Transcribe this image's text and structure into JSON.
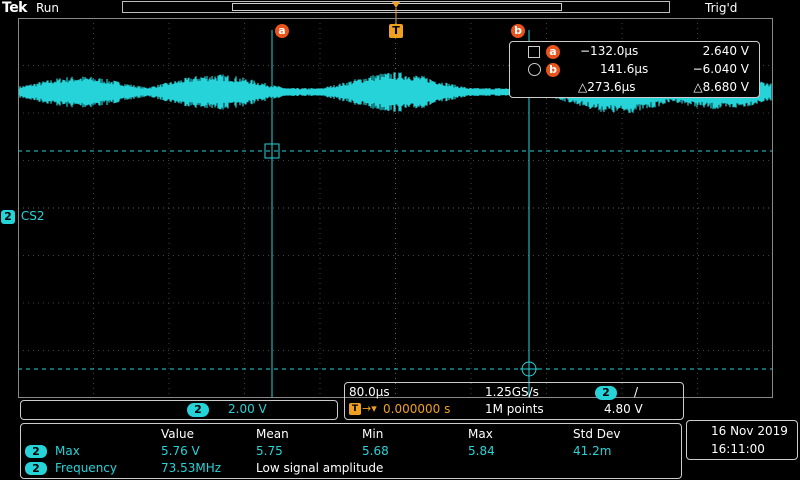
{
  "header": {
    "logo": "Tek",
    "status": "Run",
    "trigger_status": "Trig'd",
    "trigger_marker": "T"
  },
  "cursors": {
    "a_label": "a",
    "b_label": "b",
    "readout": {
      "a_time": "−132.0µs",
      "a_volt": "2.640 V",
      "b_time": "141.6µs",
      "b_volt": "−6.040 V",
      "delta_time": "△273.6µs",
      "delta_volt": "△8.680 V"
    }
  },
  "channel": {
    "badge": "2",
    "label": "CS2",
    "scale": "2.00 V",
    "color": "#26d3d9"
  },
  "timebase": {
    "time_per_div": "80.0µs",
    "sample_rate": "1.25GS/s",
    "trigger_channel": "2",
    "trigger_slope": "/",
    "trigger_position": "0.000000 s",
    "record_length": "1M points",
    "trigger_level": "4.80 V"
  },
  "measurements": {
    "headers": [
      "Value",
      "Mean",
      "Min",
      "Max",
      "Std Dev"
    ],
    "rows": [
      {
        "channel": "2",
        "name": "Max",
        "value": "5.76 V",
        "mean": "5.75",
        "min": "5.68",
        "max": "5.84",
        "stddev": "41.2m"
      },
      {
        "channel": "2",
        "name": "Frequency",
        "value": "73.53MHz",
        "note": "Low signal amplitude"
      }
    ]
  },
  "datetime": {
    "date": "16 Nov 2019",
    "time": "16:11:00"
  },
  "colors": {
    "trace": "#26d3d9",
    "cursor_marker": "#e8541c",
    "trigger_marker": "#f0a020"
  }
}
